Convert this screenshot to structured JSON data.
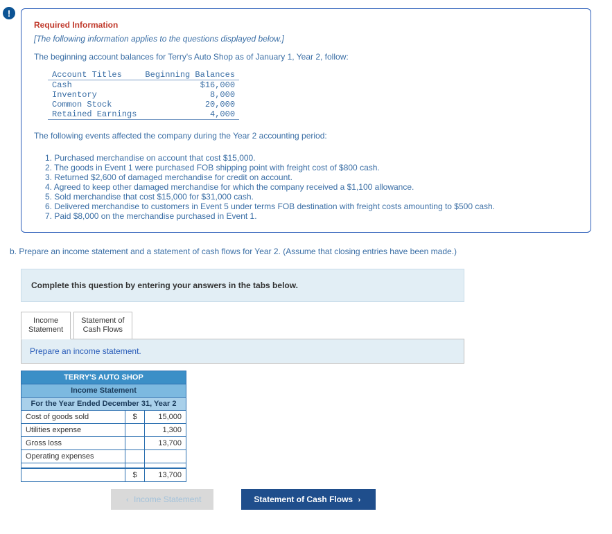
{
  "alert_symbol": "!",
  "required_title": "Required Information",
  "italic_note": "[The following information applies to the questions displayed below.]",
  "intro_text": "The beginning account balances for Terry's Auto Shop as of January 1, Year 2, follow:",
  "balances": {
    "header_titles": "Account Titles",
    "header_balances": "Beginning Balances",
    "rows": [
      {
        "title": "Cash",
        "balance": "$16,000"
      },
      {
        "title": "Inventory",
        "balance": "8,000"
      },
      {
        "title": "Common Stock",
        "balance": "20,000"
      },
      {
        "title": "Retained Earnings",
        "balance": "4,000"
      }
    ]
  },
  "events_intro": "The following events affected the company during the Year 2 accounting period:",
  "events": [
    "Purchased merchandise on account that cost $15,000.",
    "The goods in Event 1 were purchased FOB shipping point with freight cost of $800 cash.",
    "Returned $2,600 of damaged merchandise for credit on account.",
    "Agreed to keep other damaged merchandise for which the company received a $1,100 allowance.",
    "Sold merchandise that cost $15,000 for $31,000 cash.",
    "Delivered merchandise to customers in Event 5 under terms FOB destination with freight costs amounting to $500 cash.",
    "Paid $8,000 on the merchandise purchased in Event 1."
  ],
  "question_b": "b. Prepare an income statement and a statement of cash flows for Year 2. (Assume that closing entries have been made.)",
  "complete_prompt": "Complete this question by entering your answers in the tabs below.",
  "tabs": {
    "income": "Income\nStatement",
    "cashflows": "Statement of\nCash Flows"
  },
  "panel_instruction": "Prepare an income statement.",
  "statement": {
    "title": "TERRY'S AUTO SHOP",
    "subtitle": "Income Statement",
    "period": "For the Year Ended December 31, Year 2",
    "rows": [
      {
        "label": "Cost of goods sold",
        "sym": "$",
        "val": "15,000"
      },
      {
        "label": "Utilities expense",
        "sym": "",
        "val": "1,300"
      },
      {
        "label": "Gross loss",
        "sym": "",
        "val": "13,700"
      },
      {
        "label": "Operating expenses",
        "sym": "",
        "val": ""
      },
      {
        "label": "",
        "sym": "",
        "val": ""
      }
    ],
    "total": {
      "sym": "$",
      "val": "13,700"
    }
  },
  "nav": {
    "prev_label": "Income Statement",
    "next_label": "Statement of Cash Flows"
  }
}
